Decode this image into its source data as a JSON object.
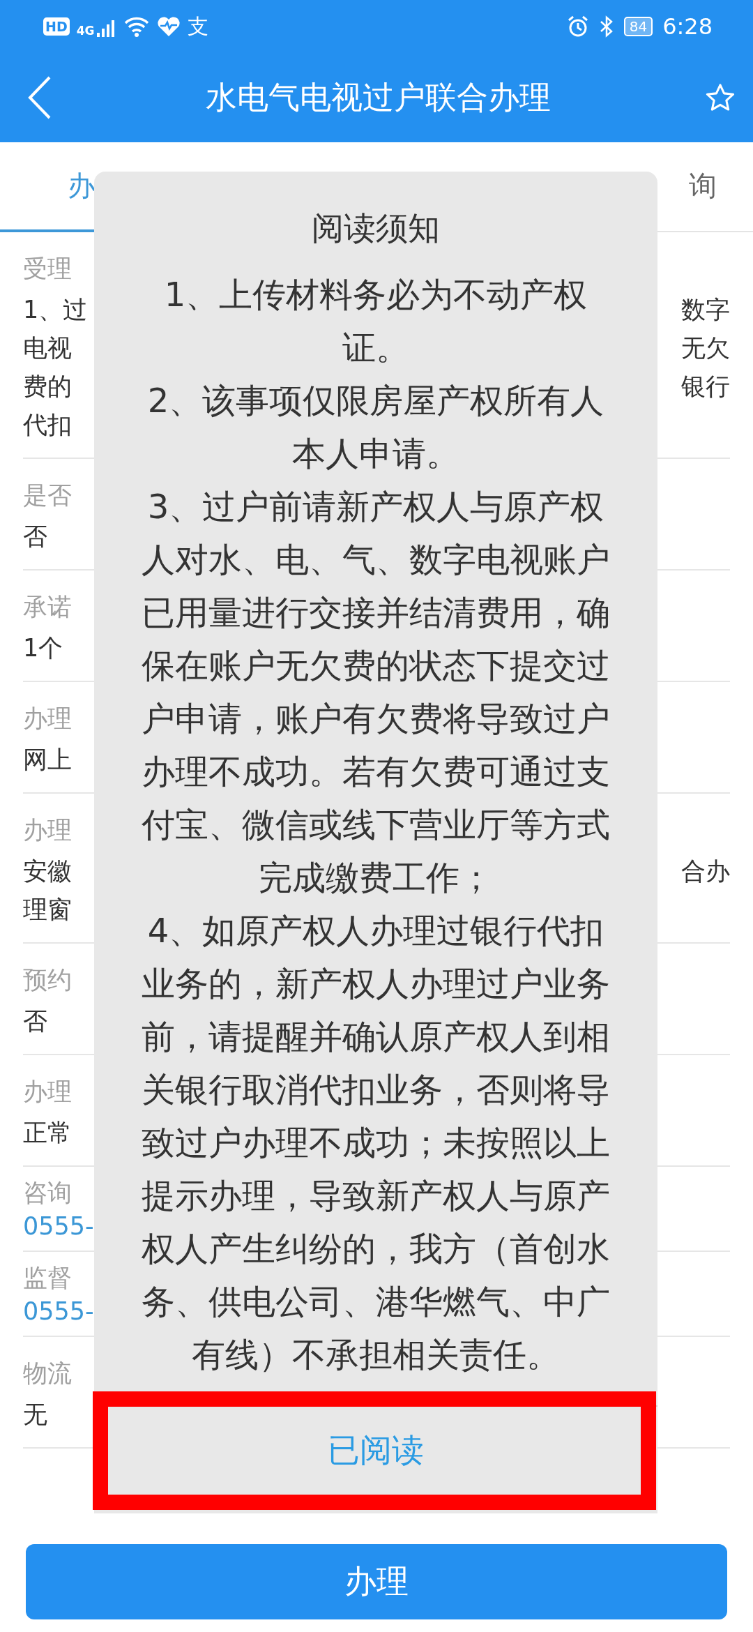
{
  "status_bar": {
    "hd": "HD",
    "network": "4G",
    "notification": "支",
    "battery": "84",
    "time": "6:28"
  },
  "header": {
    "title": "水电气电视过户联合办理"
  },
  "tabs": [
    {
      "label": "办",
      "selected": true
    },
    {
      "label": "询",
      "selected": false
    }
  ],
  "fields": [
    {
      "kind": "text",
      "label": "受理",
      "lines": [
        {
          "left": "1、过",
          "right": "数字"
        },
        {
          "left": "电视",
          "right": "无欠"
        },
        {
          "left": "费的",
          "right": "银行"
        },
        {
          "left": "代扣"
        }
      ]
    },
    {
      "kind": "text",
      "label": "是否",
      "lines": [
        {
          "left": "否"
        }
      ]
    },
    {
      "kind": "text",
      "label": "承诺",
      "lines": [
        {
          "left": "1个"
        }
      ]
    },
    {
      "kind": "text",
      "label": "办理",
      "lines": [
        {
          "left": "网上"
        }
      ]
    },
    {
      "kind": "text",
      "label": "办理",
      "lines": [
        {
          "left": "安徽",
          "right": "合办"
        },
        {
          "left": "理窗"
        }
      ]
    },
    {
      "kind": "text",
      "label": "预约",
      "lines": [
        {
          "left": "否"
        }
      ]
    },
    {
      "kind": "text",
      "label": "办理",
      "lines": [
        {
          "left": "正常"
        }
      ]
    },
    {
      "kind": "phone",
      "label": "咨询",
      "lines": [
        {
          "left": "0555-"
        }
      ]
    },
    {
      "kind": "phone",
      "label": "监督",
      "lines": [
        {
          "left": "0555-"
        }
      ]
    },
    {
      "kind": "text",
      "label": "物流",
      "lines": [
        {
          "left": "无"
        }
      ]
    }
  ],
  "dialog": {
    "title": "阅读须知",
    "paragraphs": [
      "1、上传材料务必为不动产权证。",
      "2、该事项仅限房屋产权所有人本人申请。",
      "3、过户前请新产权人与原产权人对水、电、气、数字电视账户已用量进行交接并结清费用，确保在账户无欠费的状态下提交过户申请，账户有欠费将导致过户办理不成功。若有欠费可通过支付宝、微信或线下营业厅等方式完成缴费工作；",
      "4、如原产权人办理过银行代扣业务的，新产权人办理过户业务前，请提醒并确认原产权人到相关银行取消代扣业务，否则将导致过户办理不成功；未按照以上提示办理，导致新产权人与原产权人产生纠纷的，我方（首创水务、供电公司、港华燃气、中广有线）不承担相关责任。"
    ],
    "confirm": "已阅读"
  },
  "submit": "办理"
}
